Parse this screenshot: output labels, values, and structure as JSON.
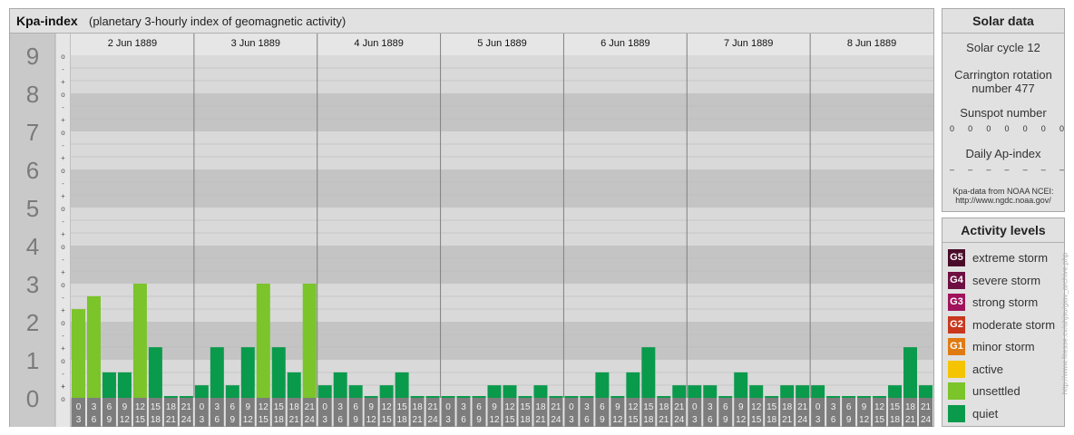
{
  "header": {
    "title": "Kpa-index",
    "subtitle": "(planetary 3-hourly index of geomagnetic activity)"
  },
  "solar": {
    "title": "Solar data",
    "cycle": "Solar cycle 12",
    "carrington_1": "Carrington rotation",
    "carrington_2": "number 477",
    "sunspot_label": "Sunspot number",
    "sunspot_values": [
      "0",
      "0",
      "0",
      "0",
      "0",
      "0",
      "0"
    ],
    "ap_label": "Daily Ap-index",
    "ap_values": [
      "–",
      "–",
      "–",
      "–",
      "–",
      "–",
      "–"
    ],
    "source_1": "Kpa-data from NOAA NCEI:",
    "source_2": "http://www.ngdc.noaa.gov/"
  },
  "activity": {
    "title": "Activity levels",
    "levels": [
      {
        "code": "G5",
        "label": "extreme storm",
        "color": "#4a0c2a"
      },
      {
        "code": "G4",
        "label": "severe storm",
        "color": "#6e0f42"
      },
      {
        "code": "G3",
        "label": "strong storm",
        "color": "#a0135c"
      },
      {
        "code": "G2",
        "label": "moderate storm",
        "color": "#c8371e"
      },
      {
        "code": "G1",
        "label": "minor storm",
        "color": "#e07a12"
      },
      {
        "code": "",
        "label": "active",
        "color": "#f5c400"
      },
      {
        "code": "",
        "label": "unsettled",
        "color": "#7bc42a"
      },
      {
        "code": "",
        "label": "quiet",
        "color": "#0a9a4c"
      }
    ]
  },
  "watermark": "http://www.fitesse.cv/ahjsu/giav_archive.php",
  "chart_data": {
    "type": "bar",
    "title": "Kpa-index",
    "subtitle": "(planetary 3-hourly index of geomagnetic activity)",
    "ylim": [
      0,
      9
    ],
    "y_major_ticks": [
      "0",
      "1",
      "2",
      "3",
      "4",
      "5",
      "6",
      "7",
      "8",
      "9"
    ],
    "y_minor_ticks": [
      "o",
      "+",
      "-",
      "o"
    ],
    "days": [
      "2 Jun 1889",
      "3 Jun 1889",
      "4 Jun 1889",
      "5 Jun 1889",
      "6 Jun 1889",
      "7 Jun 1889",
      "8 Jun 1889"
    ],
    "interval_top": [
      "0",
      "3",
      "6",
      "9",
      "12",
      "15",
      "18",
      "21"
    ],
    "interval_bottom": [
      "3",
      "6",
      "9",
      "12",
      "15",
      "18",
      "21",
      "24"
    ],
    "values": [
      [
        2.33,
        2.67,
        0.67,
        0.67,
        3.0,
        1.33,
        0,
        0
      ],
      [
        0.33,
        1.33,
        0.33,
        1.33,
        3.0,
        1.33,
        0.67,
        3.0
      ],
      [
        0.33,
        0.67,
        0.33,
        0,
        0.33,
        0.67,
        0,
        0
      ],
      [
        0,
        0,
        0,
        0.33,
        0.33,
        0,
        0.33,
        0
      ],
      [
        0,
        0,
        0.67,
        0,
        0.67,
        1.33,
        0,
        0.33
      ],
      [
        0.33,
        0.33,
        0,
        0.67,
        0.33,
        0,
        0.33,
        0.33
      ],
      [
        0.33,
        0,
        0,
        0,
        0,
        0.33,
        1.33,
        0.33
      ]
    ],
    "colors": {
      "quiet": "#0a9a4c",
      "unsettled": "#7bc42a"
    }
  }
}
